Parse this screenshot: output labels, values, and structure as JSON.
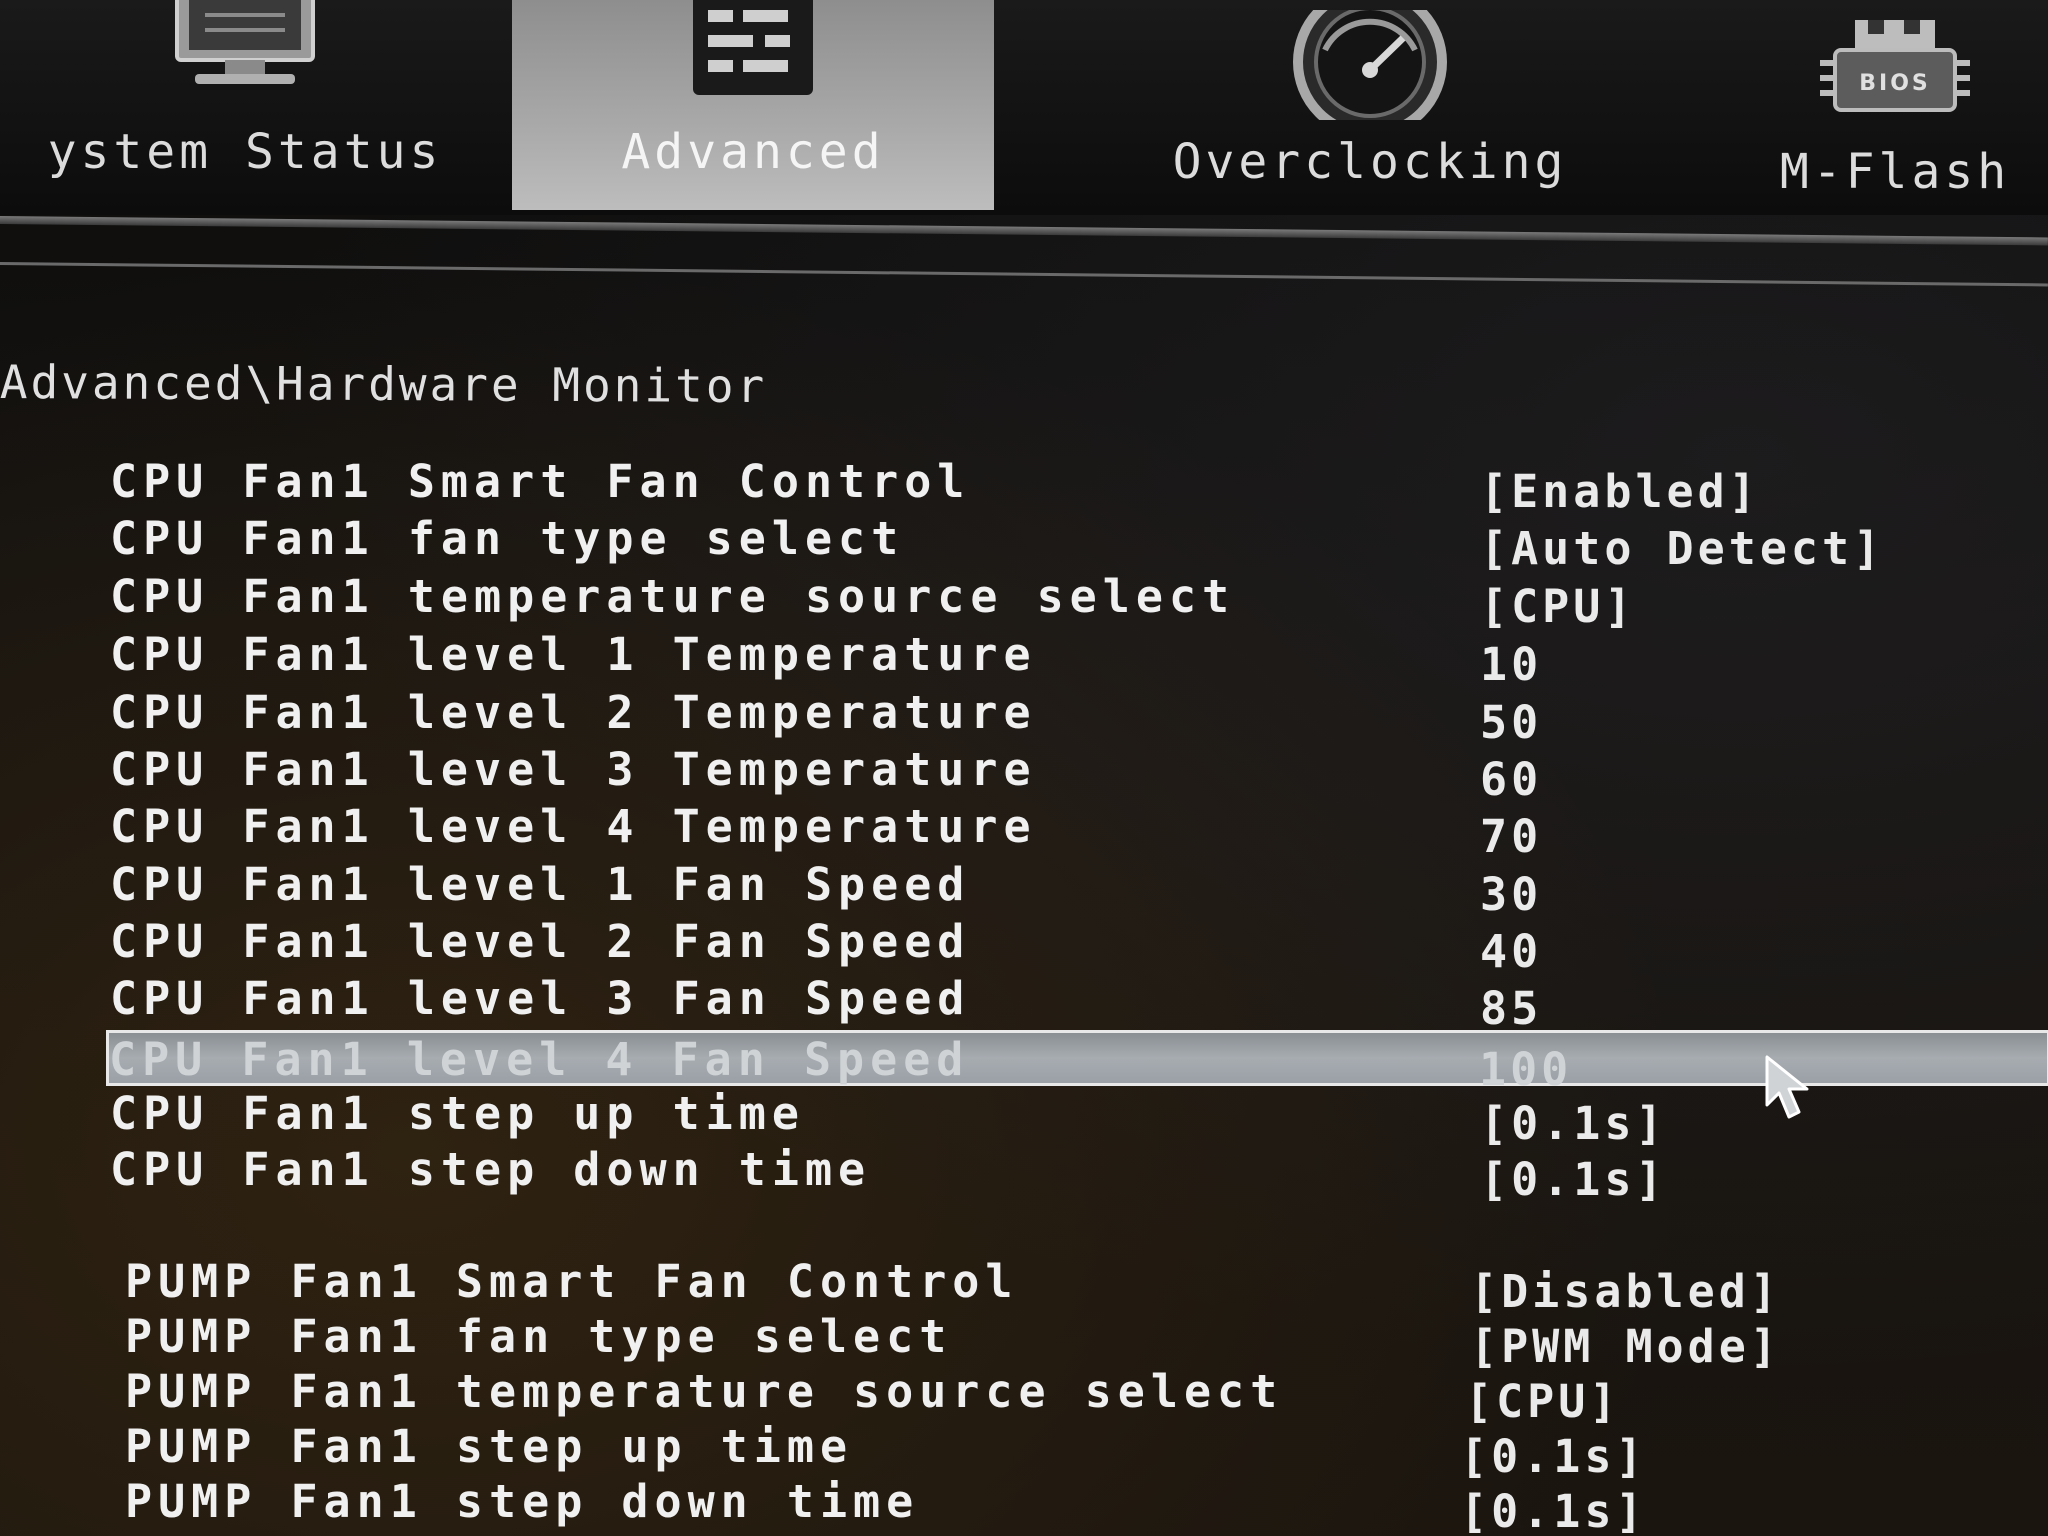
{
  "tabs": [
    {
      "id": "system",
      "label": "ystem Status",
      "icon": "monitor-icon"
    },
    {
      "id": "advanced",
      "label": "Advanced",
      "icon": "settings-panel-icon",
      "active": true
    },
    {
      "id": "overclocking",
      "label": "Overclocking",
      "icon": "speedometer-icon"
    },
    {
      "id": "mflash",
      "label": "M-Flash",
      "icon": "bios-chip-icon",
      "icon_text": "BIOS"
    }
  ],
  "breadcrumb": "Advanced\\Hardware Monitor",
  "settings": [
    {
      "label": "CPU Fan1 Smart Fan Control",
      "value": "[Enabled]"
    },
    {
      "label": "CPU Fan1 fan type select",
      "value": "[Auto Detect]"
    },
    {
      "label": "CPU Fan1 temperature source select",
      "value": "[CPU]"
    },
    {
      "label": "CPU Fan1 level 1 Temperature",
      "value": "10"
    },
    {
      "label": "CPU Fan1 level 2 Temperature",
      "value": "50"
    },
    {
      "label": "CPU Fan1 level 3 Temperature",
      "value": "60"
    },
    {
      "label": "CPU Fan1 level 4 Temperature",
      "value": "70"
    },
    {
      "label": "CPU Fan1 level 1 Fan Speed",
      "value": "30"
    },
    {
      "label": "CPU Fan1 level 2 Fan Speed",
      "value": "40"
    },
    {
      "label": "CPU Fan1 level 3 Fan Speed",
      "value": "85"
    },
    {
      "label": "CPU Fan1 level 4 Fan Speed",
      "value": "100",
      "selected": true
    },
    {
      "label": "CPU Fan1 step up time",
      "value": "[0.1s]"
    },
    {
      "label": "CPU Fan1 step down time",
      "value": "[0.1s]"
    },
    {
      "label": "PUMP Fan1 Smart Fan Control",
      "value": "[Disabled]"
    },
    {
      "label": "PUMP Fan1 fan type select",
      "value": "[PWM Mode]"
    },
    {
      "label": "PUMP Fan1 temperature source select",
      "value": "[CPU]"
    },
    {
      "label": "PUMP Fan1 step up time",
      "value": "[0.1s]"
    },
    {
      "label": "PUMP Fan1 step down time",
      "value": "[0.1s]"
    }
  ],
  "colors": {
    "background": "#000000",
    "text": "#e6e6e6",
    "active_tab": "#a9a9a9",
    "selection": "#9aa0a6"
  }
}
